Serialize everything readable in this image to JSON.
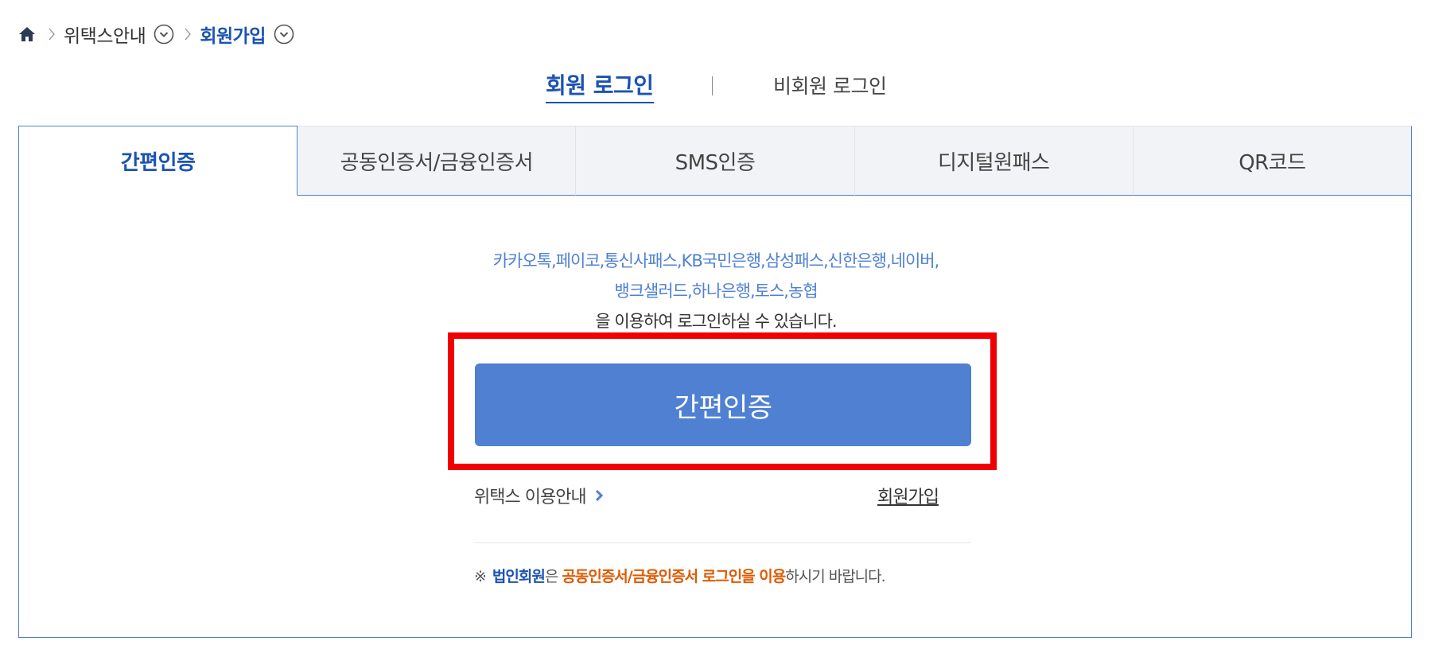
{
  "breadcrumb": {
    "home_icon": "home-icon",
    "items": [
      {
        "label": "위택스안내"
      },
      {
        "label": "회원가입"
      }
    ]
  },
  "login_switch": {
    "member_login": "회원 로그인",
    "guest_login": "비회원 로그인"
  },
  "tabs": [
    {
      "label": "간편인증",
      "active": true
    },
    {
      "label": "공동인증서/금융인증서",
      "active": false
    },
    {
      "label": "SMS인증",
      "active": false
    },
    {
      "label": "디지털원패스",
      "active": false
    },
    {
      "label": "QR코드",
      "active": false
    }
  ],
  "panel": {
    "providers_line1": "카카오톡,페이코,통신사패스,KB국민은행,삼성패스,신한은행,네이버,",
    "providers_line2": "뱅크샐러드,하나은행,토스,농협",
    "providers_note": "을 이용하여 로그인하실 수 있습니다.",
    "auth_button": "간편인증",
    "guide_link": "위택스 이용안내",
    "join_link": "회원가입",
    "notice": {
      "mark": "※",
      "part1": "법인회원",
      "part2": "은 ",
      "part3": "공동인증서/금융인증서 로그인을 이용",
      "part4": "하시기 바랍니다."
    }
  },
  "colors": {
    "accent_blue": "#4f80d2",
    "active_blue": "#1b53b2",
    "highlight_red": "#f00000",
    "notice_orange": "#e05a00"
  }
}
